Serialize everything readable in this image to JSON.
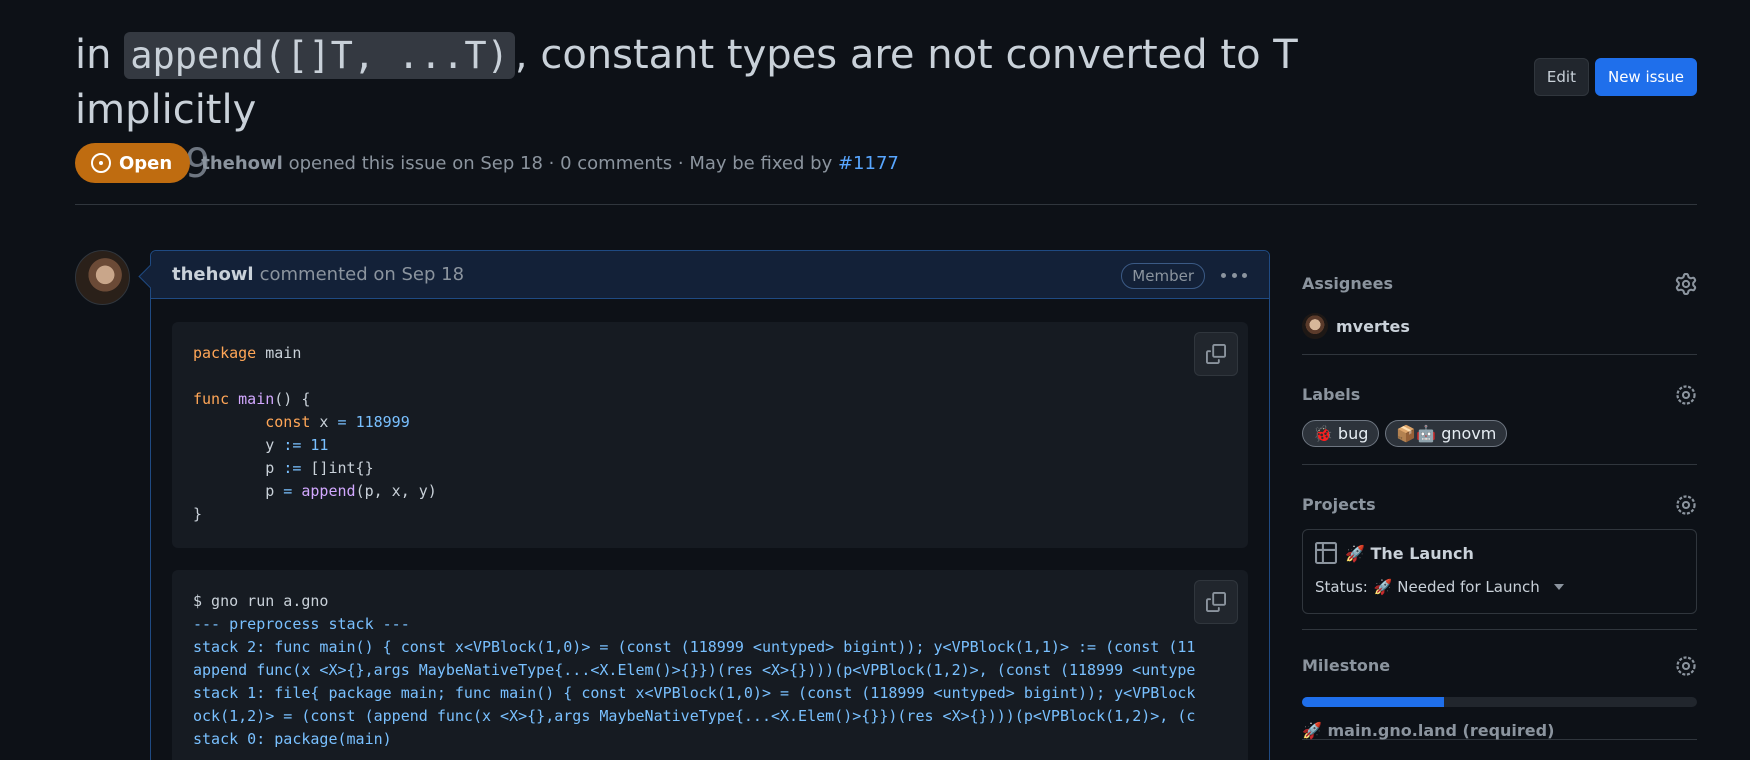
{
  "issue": {
    "title_prefix": "in ",
    "title_code": "append([]T, ...T)",
    "title_suffix": ", constant types are not converted to T implicitly",
    "number": "#1149",
    "state": "Open",
    "author": "thehowl",
    "opened_text": "opened this issue on Sep 18 · 0 comments · May be fixed by",
    "fixed_by": "#1177"
  },
  "header_actions": {
    "edit_label": "Edit",
    "new_issue_label": "New issue"
  },
  "comment": {
    "author": "thehowl",
    "action_text": "commented on Sep 18",
    "role_badge": "Member"
  },
  "code_block_1": {
    "lines": [
      "package main",
      "",
      "func main() {",
      "        const x = 118999",
      "        y := 11",
      "        p := []int{}",
      "        p = append(p, x, y)",
      "}"
    ]
  },
  "code_block_2": {
    "lines": [
      "$ gno run a.gno",
      "--- preprocess stack ---",
      "stack 2: func main() { const x<VPBlock(1,0)> = (const (118999 <untyped> bigint)); y<VPBlock(1,1)> := (const (11",
      "append func(x <X>{},args MaybeNativeType{...<X.Elem()>{}})(res <X>{})))(p<VPBlock(1,2)>, (const (118999 <untype",
      "stack 1: file{ package main; func main() { const x<VPBlock(1,0)> = (const (118999 <untyped> bigint)); y<VPBlock",
      "ock(1,2)> = (const (append func(x <X>{},args MaybeNativeType{...<X.Elem()>{}})(res <X>{})))(p<VPBlock(1,2)>, (c",
      "stack 0: package(main)"
    ]
  },
  "sidebar": {
    "assignees": {
      "title": "Assignees",
      "items": [
        {
          "name": "mvertes"
        }
      ]
    },
    "labels": {
      "title": "Labels",
      "items": [
        {
          "emoji": "🐞",
          "name": "bug"
        },
        {
          "emoji": "📦🤖",
          "name": "gnovm"
        }
      ]
    },
    "projects": {
      "title": "Projects",
      "project_name": "🚀 The Launch",
      "status_label": "Status:",
      "status_value": "🚀 Needed for Launch"
    },
    "milestone": {
      "title": "Milestone",
      "progress_fraction": 0.36,
      "name": "🚀 main.gno.land (required)"
    }
  },
  "colors": {
    "background": "#0d1117",
    "open_badge": "#bf6c10",
    "link": "#58a6ff",
    "primary_button": "#1f6feb"
  }
}
